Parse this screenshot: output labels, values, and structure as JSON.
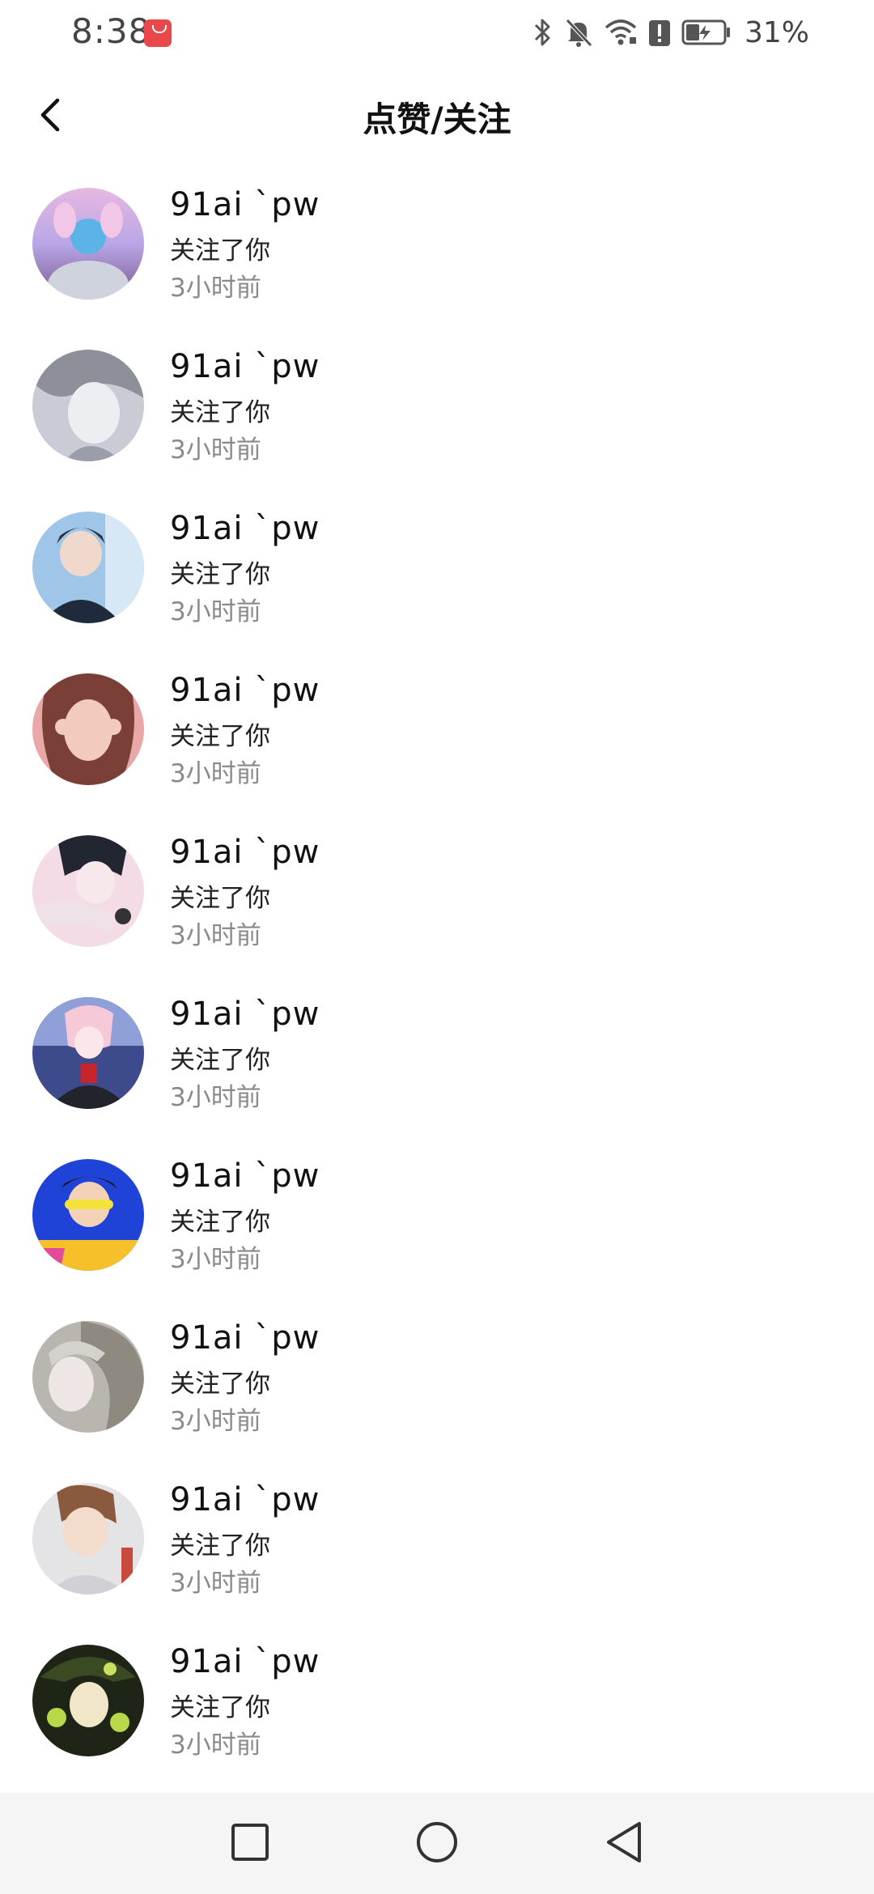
{
  "status_bar": {
    "time": "8:38",
    "battery_percent": "31%",
    "icons": [
      "app-badge-icon",
      "bluetooth-icon",
      "mute-icon",
      "wifi-icon",
      "alert-icon",
      "battery-charging-icon"
    ]
  },
  "header": {
    "title": "点赞/关注",
    "back_icon": "chevron-left-icon"
  },
  "notifications": [
    {
      "name": "91ai `pw",
      "action": "关注了你",
      "time": "3小时前"
    },
    {
      "name": "91ai `pw",
      "action": "关注了你",
      "time": "3小时前"
    },
    {
      "name": "91ai `pw",
      "action": "关注了你",
      "time": "3小时前"
    },
    {
      "name": "91ai `pw",
      "action": "关注了你",
      "time": "3小时前"
    },
    {
      "name": "91ai `pw",
      "action": "关注了你",
      "time": "3小时前"
    },
    {
      "name": "91ai `pw",
      "action": "关注了你",
      "time": "3小时前"
    },
    {
      "name": "91ai `pw",
      "action": "关注了你",
      "time": "3小时前"
    },
    {
      "name": "91ai `pw",
      "action": "关注了你",
      "time": "3小时前"
    },
    {
      "name": "91ai `pw",
      "action": "关注了你",
      "time": "3小时前"
    },
    {
      "name": "91ai `pw",
      "action": "关注了你",
      "time": "3小时前"
    }
  ],
  "nav_bar": {
    "icons": [
      "recent-apps-icon",
      "home-icon",
      "back-triangle-icon"
    ]
  }
}
